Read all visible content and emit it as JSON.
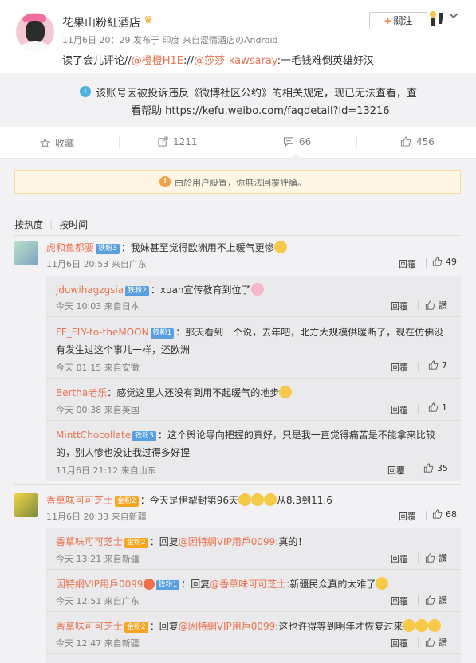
{
  "post": {
    "author": "花果山粉紅酒店",
    "meta": "11月6日 20：29 发布于 印度 来自涩情酒店のAndroid",
    "text_prefix": "读了会儿评论//",
    "mention1": "@橙橙H1E",
    "text_mid": "://",
    "mention2": "@莎莎-kawsaray",
    "text_suffix": ":一毛钱难倒英雄好汉",
    "follow_label": "關注"
  },
  "notice": {
    "line1": "该账号因被投诉违反《微博社区公约》的相关规定，现已无法查看，查",
    "line2": "看帮助 https://kefu.weibo.com/faqdetail?id=13216"
  },
  "actions": {
    "favorite": "收藏",
    "repost_count": "1211",
    "comment_count": "66",
    "like_count": "456"
  },
  "warning": {
    "text": "由於用户設置，你無法回覆評論。"
  },
  "sort": {
    "hot": "按热度",
    "time": "按时间"
  },
  "comments": [
    {
      "name": "虎和鱼都要",
      "badge": "铁粉3",
      "text": "：我妹甚至觉得欧洲用不上暖气更惨",
      "meta": "11月6日 20:53 来自广东",
      "reply": "回覆",
      "likes": "49"
    },
    {
      "name": "jduwihagzgsia",
      "badge": "铁粉2",
      "text": "：xuan宣传教育到位了",
      "meta": "今天 10:03 来自日本",
      "reply": "回覆",
      "likes": "讚"
    },
    {
      "name": "FF_FLY-to-theMOON",
      "badge": "铁粉1",
      "text": "：那天看到一个说，去年吧，北方大规模供暖断了，现在仿佛没",
      "text2": "有发生过这个事儿一样，还欧洲",
      "meta": "今天 01:15 来自安徽",
      "reply": "回覆",
      "likes": "7"
    },
    {
      "name": "Bertha老乐",
      "text": "：感觉这里人还没有到用不起暖气的地步",
      "meta": "今天 00:38 来自英国",
      "reply": "回覆",
      "likes": "1"
    },
    {
      "name": "MinttChocollate",
      "badge": "铁粉3",
      "text": "：这个舆论导向把握的真好，只是我一直觉得痛苦是不能拿来比较",
      "text2": "的，别人惨也没让我过得多好捏",
      "meta": "11月6日 21:12 来自山东",
      "reply": "回覆",
      "likes": "35"
    },
    {
      "name": "香草味可可芝士",
      "badge": "金粉2",
      "text": "：今天是伊犁封第96天",
      "text_after": "从8.3到11.6",
      "meta": "11月6日 20:33 来自新疆",
      "reply": "回覆",
      "likes": "68"
    },
    {
      "name": "香草味可可芝士",
      "badge": "金粉2",
      "text": "：回复",
      "mention": "@因特網VIP用戶0099",
      "text_after": ":真的！",
      "meta": "今天 13:21 来自新疆",
      "reply": "回覆",
      "likes": "讚"
    },
    {
      "name": "因特網VIP用戶0099",
      "badge": "铁粉1",
      "text": "：回复",
      "mention": "@香草味可可芝士",
      "text_after": ":新疆民众真的太难了",
      "meta": "今天 12:51 来自广东",
      "reply": "回覆",
      "likes": "讚"
    },
    {
      "name": "香草味可可芝士",
      "badge": "金粉2",
      "text": "：回复",
      "mention": "@因特網VIP用戶0099",
      "text_after": ":这也许得等到明年才恢复过来",
      "meta": "今天 12:47 来自新疆",
      "reply": "回覆",
      "likes": "讚"
    }
  ]
}
